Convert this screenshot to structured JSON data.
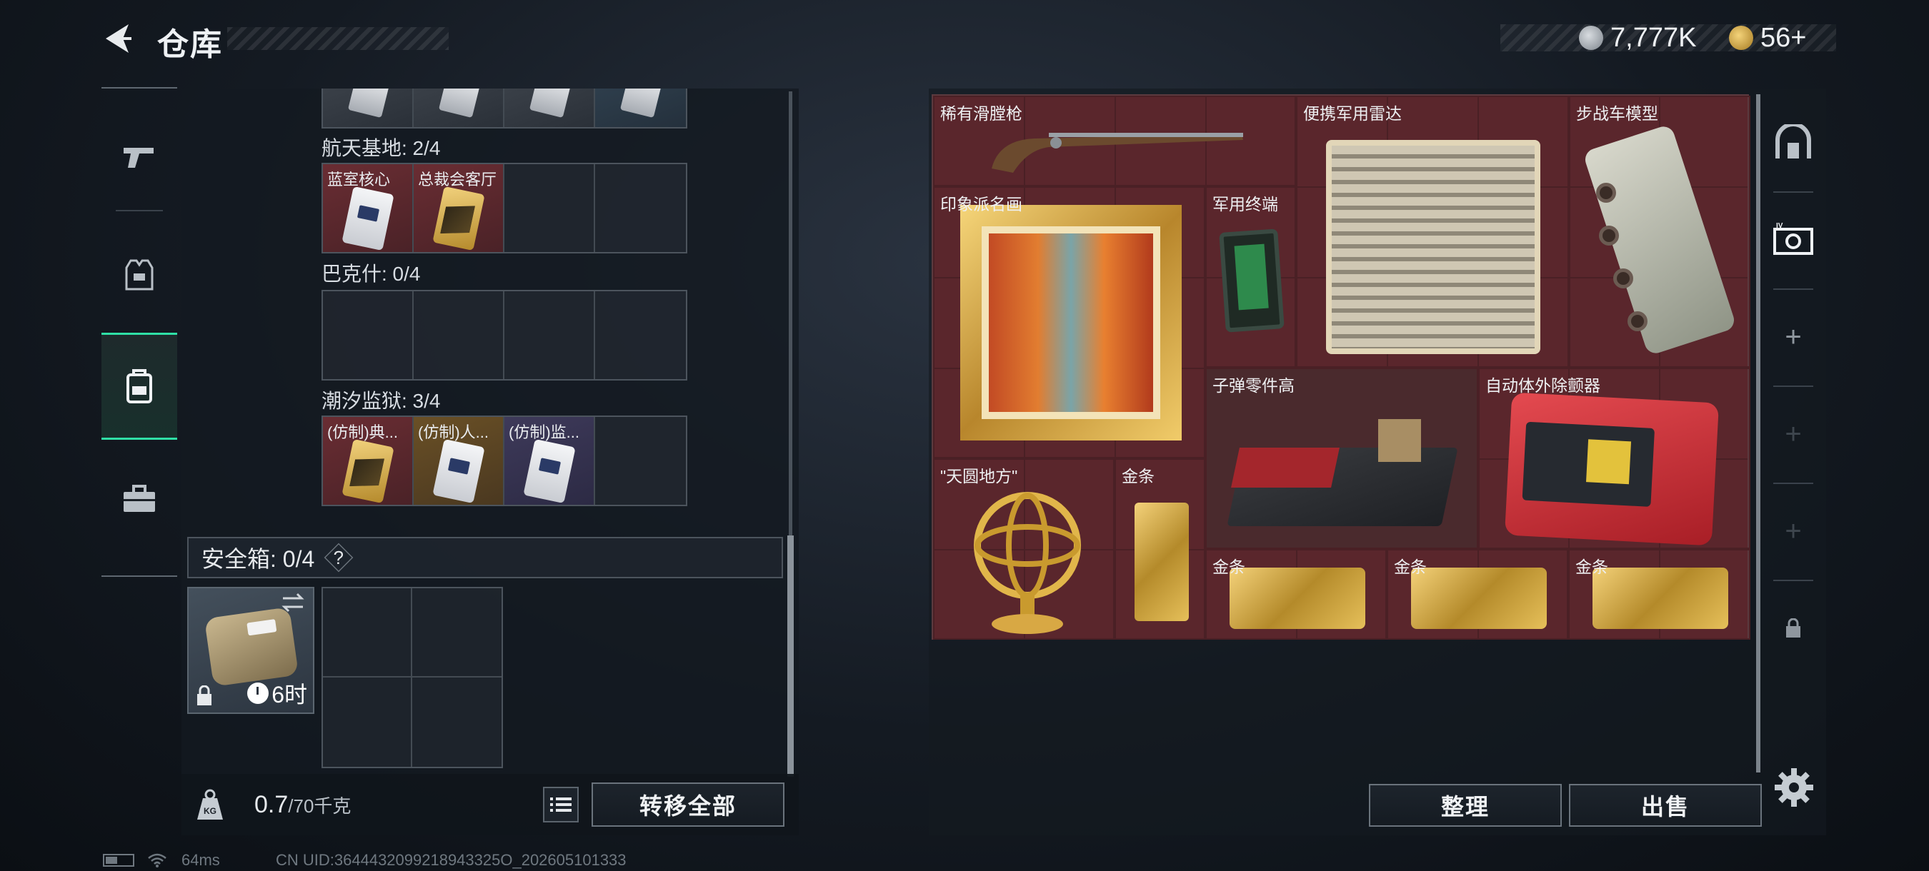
{
  "header": {
    "title": "仓库",
    "currency_silver": "7,777K",
    "currency_gold": "56+"
  },
  "left_tabs": [
    "weapon-tab",
    "armor-tab",
    "backpack-tab",
    "toolbox-tab"
  ],
  "collections": [
    {
      "label": "航天基地: 2/4",
      "items": [
        "蓝室核心",
        "总裁会客厅"
      ]
    },
    {
      "label": "巴克什: 0/4",
      "items": []
    },
    {
      "label": "潮汐监狱: 3/4",
      "items": [
        "(仿制)典...",
        "(仿制)人...",
        "(仿制)监..."
      ]
    }
  ],
  "safe_box": {
    "label": "安全箱: 0/4",
    "help": "?",
    "timer": "6时"
  },
  "weight": {
    "current": "0.7",
    "max": "/70千克"
  },
  "buttons": {
    "transfer_all": "转移全部",
    "sort": "整理",
    "sell": "出售"
  },
  "stash_items": {
    "flintlock": "稀有滑膛枪",
    "radar": "便携军用雷达",
    "ifv": "步战车模型",
    "painting": "印象派名画",
    "terminal": "军用终端",
    "ammo_parts": "子弹零件高",
    "aed": "自动体外除颤器",
    "armillary": "\"天圆地方\"",
    "gold1": "金条",
    "gold2": "金条",
    "gold3": "金条",
    "gold4": "金条"
  },
  "status_bar": {
    "ping": "64ms",
    "uid": "CN UID:3644432099218943325O_202605101333"
  },
  "colors": {
    "accent": "#2fe0a6",
    "stash_bg": "#5a262c",
    "gold": "#d9b24a"
  }
}
